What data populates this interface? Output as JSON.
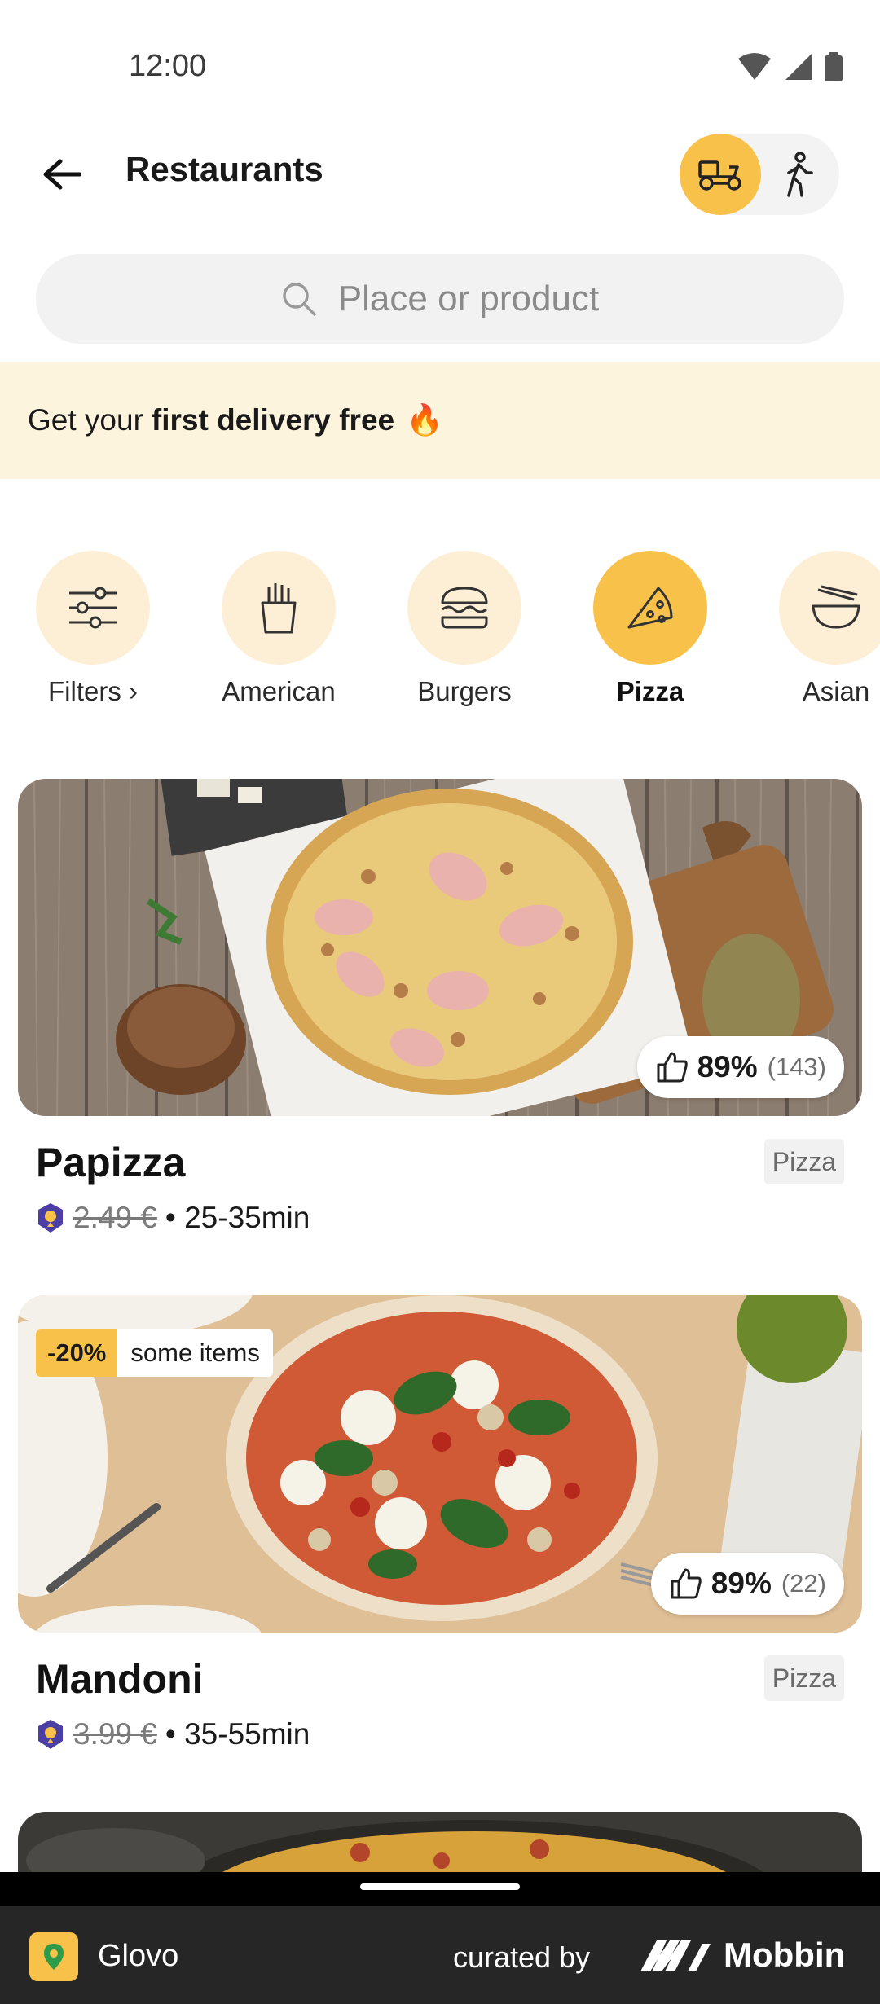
{
  "status_bar": {
    "time": "12:00"
  },
  "header": {
    "title": "Restaurants"
  },
  "search": {
    "placeholder": "Place or product"
  },
  "promo": {
    "prefix": "Get your",
    "bold": "first delivery free",
    "emoji": "🔥"
  },
  "categories": [
    {
      "label": "Filters ›",
      "icon": "sliders-icon",
      "active": false
    },
    {
      "label": "American",
      "icon": "fries-icon",
      "active": false
    },
    {
      "label": "Burgers",
      "icon": "burger-icon",
      "active": false
    },
    {
      "label": "Pizza",
      "icon": "pizza-slice-icon",
      "active": true
    },
    {
      "label": "Asian",
      "icon": "noodle-bowl-icon",
      "active": false
    }
  ],
  "restaurants": [
    {
      "name": "Papizza",
      "tag": "Pizza",
      "rating": "89%",
      "rating_count": "(143)",
      "old_price": "2.49 €",
      "time": "• 25-35min"
    },
    {
      "name": "Mandoni",
      "tag": "Pizza",
      "rating": "89%",
      "rating_count": "(22)",
      "old_price": "3.99 €",
      "time": "• 35-55min",
      "discount": "-20%",
      "discount_note": "some items"
    }
  ],
  "footer": {
    "app_name": "Glovo",
    "curated_by": "curated by",
    "brand": "Mobbin"
  },
  "colors": {
    "accent": "#f8c24a",
    "promo_bg": "#fdf4dd",
    "category_bg": "#fdefd6",
    "prime_badge": "#4b3fa6"
  }
}
